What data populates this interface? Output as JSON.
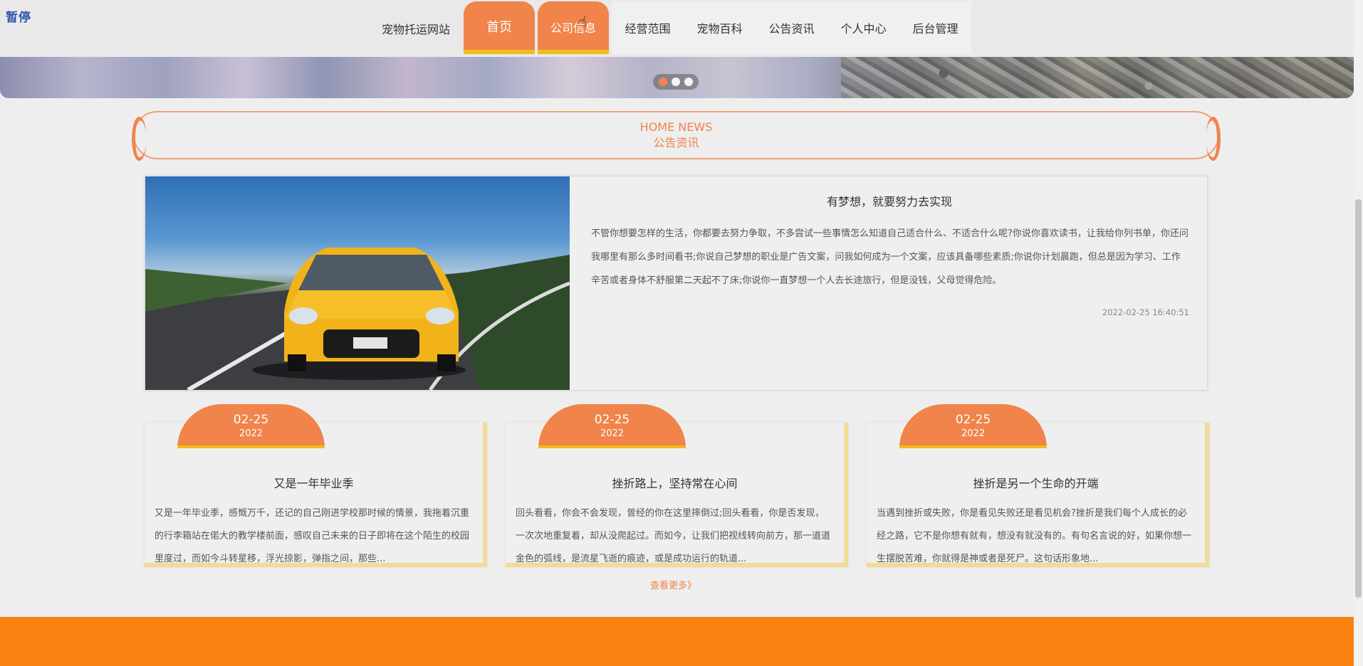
{
  "pause_label": "暂停",
  "header": {
    "site_title": "宠物托运网站",
    "nav": [
      {
        "label": "首页"
      },
      {
        "label": "公司信息"
      },
      {
        "label": "经营范围"
      },
      {
        "label": "宠物百科"
      },
      {
        "label": "公告资讯"
      },
      {
        "label": "个人中心"
      },
      {
        "label": "后台管理"
      }
    ]
  },
  "carousel": {
    "dots": 3,
    "active_index": 0
  },
  "section": {
    "title_en": "HOME NEWS",
    "title_cn": "公告资讯"
  },
  "featured": {
    "title": "有梦想，就要努力去实现",
    "body": "不管你想要怎样的生活，你都要去努力争取，不多尝试一些事情怎么知道自己适合什么、不适合什么呢?你说你喜欢读书，让我给你列书单，你还问我哪里有那么多时间看书;你说自己梦想的职业是广告文案，问我如何成为一个文案，应该具备哪些素质;你说你计划晨跑，但总是因为学习、工作辛苦或者身体不舒服第二天起不了床;你说你一直梦想一个人去长途旅行，但是没钱，父母觉得危险。",
    "date": "2022-02-25 16:40:51",
    "image_icon": "sports-car-photo"
  },
  "cards": [
    {
      "month_day": "02-25",
      "year": "2022",
      "title": "又是一年毕业季",
      "body": "又是一年毕业季，感慨万千，还记的自己刚进学校那时候的情景，我拖着沉重的行李箱站在偌大的教学楼前面，感叹自己未来的日子即将在这个陌生的校园里度过，而如今斗转星移，浮光掠影，弹指之间，那些..."
    },
    {
      "month_day": "02-25",
      "year": "2022",
      "title": "挫折路上，坚持常在心间",
      "body": "回头看看，你会不会发现，曾经的你在这里摔倒过;回头看看，你是否发现，一次次地重复着，却从没爬起过。而如今，让我们把视线转向前方，那一道道金色的弧线，是流星飞逝的痕迹，或是成功运行的轨道..."
    },
    {
      "month_day": "02-25",
      "year": "2022",
      "title": "挫折是另一个生命的开端",
      "body": "当遇到挫折或失败，你是看见失败还是看见机会?挫折是我们每个人成长的必经之路，它不是你想有就有，想没有就没有的。有句名言说的好，如果你想一生摆脱苦难，你就得是神或者是死尸。这句话形象地..."
    }
  ],
  "more_link": "查看更多》",
  "colors": {
    "accent": "#f0844a",
    "highlight": "#f1bd1a",
    "footer": "#f8810f"
  }
}
